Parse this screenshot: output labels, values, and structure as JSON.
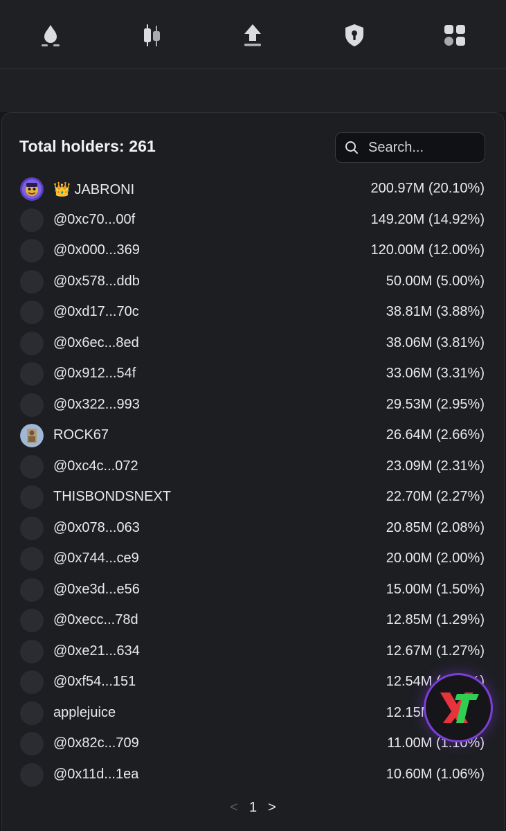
{
  "nav": {
    "icons": [
      "flame-icon",
      "candlestick-icon",
      "upload-icon",
      "shield-lock-icon",
      "grid-apps-icon"
    ]
  },
  "holders": {
    "title": "Total holders: 261",
    "search_placeholder": "Search...",
    "rows": [
      {
        "name": "👑 JABRONI",
        "amount": "200.97M (20.10%)",
        "avatar": "jabroni-avatar"
      },
      {
        "name": "@0xc70...00f",
        "amount": "149.20M (14.92%)",
        "avatar": "placeholder"
      },
      {
        "name": "@0x000...369",
        "amount": "120.00M (12.00%)",
        "avatar": "placeholder"
      },
      {
        "name": "@0x578...ddb",
        "amount": "50.00M (5.00%)",
        "avatar": "placeholder"
      },
      {
        "name": "@0xd17...70c",
        "amount": "38.81M (3.88%)",
        "avatar": "placeholder"
      },
      {
        "name": "@0x6ec...8ed",
        "amount": "38.06M (3.81%)",
        "avatar": "placeholder"
      },
      {
        "name": "@0x912...54f",
        "amount": "33.06M (3.31%)",
        "avatar": "placeholder"
      },
      {
        "name": "@0x322...993",
        "amount": "29.53M (2.95%)",
        "avatar": "placeholder"
      },
      {
        "name": "ROCK67",
        "amount": "26.64M (2.66%)",
        "avatar": "rock67-avatar"
      },
      {
        "name": "@0xc4c...072",
        "amount": "23.09M (2.31%)",
        "avatar": "placeholder"
      },
      {
        "name": "THISBONDSNEXT",
        "amount": "22.70M (2.27%)",
        "avatar": "placeholder"
      },
      {
        "name": "@0x078...063",
        "amount": "20.85M (2.08%)",
        "avatar": "placeholder"
      },
      {
        "name": "@0x744...ce9",
        "amount": "20.00M (2.00%)",
        "avatar": "placeholder"
      },
      {
        "name": "@0xe3d...e56",
        "amount": "15.00M (1.50%)",
        "avatar": "placeholder"
      },
      {
        "name": "@0xecc...78d",
        "amount": "12.85M (1.29%)",
        "avatar": "placeholder"
      },
      {
        "name": "@0xe21...634",
        "amount": "12.67M (1.27%)",
        "avatar": "placeholder"
      },
      {
        "name": "@0xf54...151",
        "amount": "12.54M (1.25%)",
        "avatar": "placeholder"
      },
      {
        "name": "applejuice",
        "amount": "12.15M (1.22%)",
        "avatar": "placeholder"
      },
      {
        "name": "@0x82c...709",
        "amount": "11.00M (1.10%)",
        "avatar": "placeholder"
      },
      {
        "name": "@0x11d...1ea",
        "amount": "10.60M (1.06%)",
        "avatar": "placeholder"
      }
    ]
  },
  "pagination": {
    "prev": "<",
    "current": "1",
    "next": ">"
  },
  "badge": {
    "icon": "xt-logo-icon",
    "colors": {
      "ring": "#7b3fd6",
      "red": "#e8323c",
      "green": "#2fcf52"
    }
  }
}
